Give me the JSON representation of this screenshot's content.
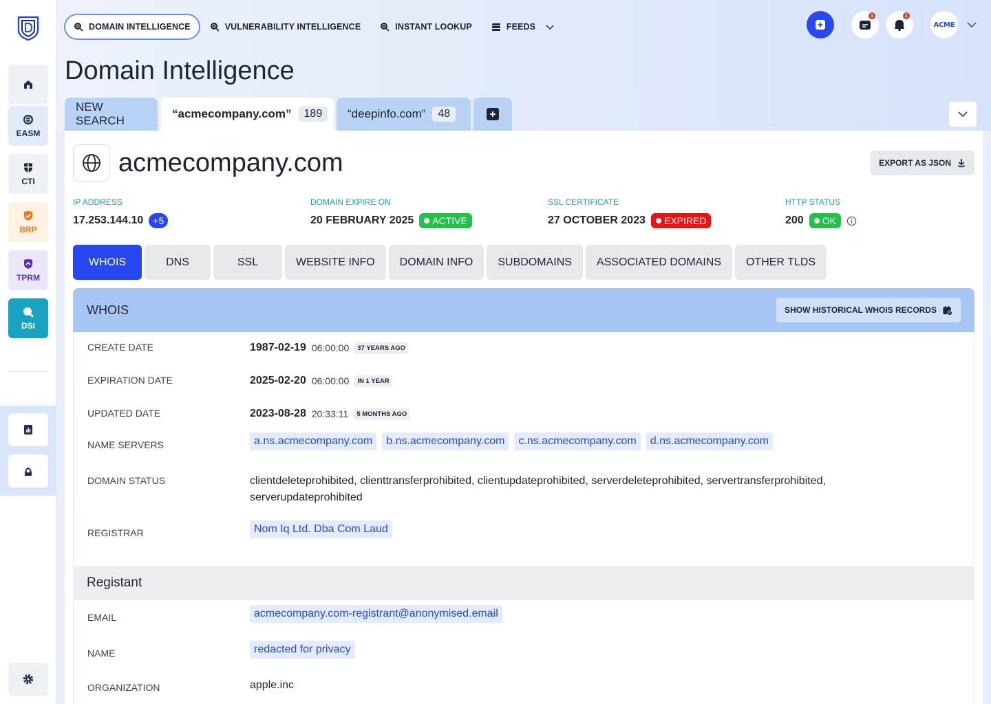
{
  "nav": {
    "items": [
      {
        "label": "DOMAIN INTELLIGENCE",
        "icon": "search-globe-icon"
      },
      {
        "label": "VULNERABILITY INTELLIGENCE",
        "icon": "search-globe-icon"
      },
      {
        "label": "INSTANT LOOKUP",
        "icon": "search-globe-icon"
      },
      {
        "label": "FEEDS",
        "icon": "feeds-icon"
      }
    ],
    "notifications": {
      "messages": "1",
      "alerts": "1"
    },
    "account_logo": "ACME"
  },
  "sidebar": {
    "items": [
      {
        "label": "",
        "icon": "home-icon"
      },
      {
        "label": "EASM",
        "icon": "globe-icon"
      },
      {
        "label": "CTI",
        "icon": "shield-icon"
      },
      {
        "label": "BRP",
        "icon": "shield-check-icon"
      },
      {
        "label": "TPRM",
        "icon": "shield-badge-icon"
      },
      {
        "label": "DSI",
        "icon": "search-icon"
      }
    ]
  },
  "page": {
    "title": "Domain Intelligence"
  },
  "tabs": [
    {
      "label": "NEW SEARCH",
      "count": ""
    },
    {
      "label": "“acmecompany.com”",
      "count": "189"
    },
    {
      "label": "“deepinfo.com”",
      "count": "48"
    }
  ],
  "domain": {
    "name": "acmecompany.com",
    "export_label": "EXPORT AS JSON",
    "meta": {
      "ip": {
        "label": "IP ADDRESS",
        "value": "17.253.144.10",
        "extra": "+5"
      },
      "expire": {
        "label": "DOMAIN EXPIRE ON",
        "value": "20 FEBRUARY 2025",
        "status": "ACTIVE"
      },
      "ssl": {
        "label": "SSL CERTIFICATE",
        "value": "27 OCTOBER 2023",
        "status": "EXPIRED"
      },
      "http": {
        "label": "HTTP STATUS",
        "value": "200",
        "status": "OK"
      }
    }
  },
  "subtabs": [
    "WHOIS",
    "DNS",
    "SSL",
    "WEBSITE INFO",
    "DOMAIN INFO",
    "SUBDOMAINS",
    "ASSOCIATED DOMAINS",
    "OTHER TLDS"
  ],
  "whois": {
    "title": "WHOIS",
    "history_label": "SHOW HISTORICAL WHOIS RECORDS",
    "create": {
      "label": "CREATE DATE",
      "date": "1987-02-19",
      "time": "06:00:00",
      "ago": "37 YEARS AGO"
    },
    "expiration": {
      "label": "EXPIRATION DATE",
      "date": "2025-02-20",
      "time": "06:00:00",
      "ago": "IN 1 YEAR"
    },
    "updated": {
      "label": "UPDATED DATE",
      "date": "2023-08-28",
      "time": "20:33:11",
      "ago": "5 MONTHS AGO"
    },
    "name_servers": {
      "label": "NAME SERVERS",
      "values": [
        "a.ns.acmecompany.com",
        "b.ns.acmecompany.com",
        "c.ns.acmecompany.com",
        "d.ns.acmecompany.com"
      ]
    },
    "status": {
      "label": "DOMAIN STATUS",
      "line1": "clientdeleteprohibited, clienttransferprohibited, clientupdateprohibited, serverdeleteprohibited, servertransferprohibited,",
      "line2": "serverupdateprohibited"
    },
    "registrar": {
      "label": "REGISTRAR",
      "value": "Nom Iq Ltd. Dba Com Laud"
    }
  },
  "registant": {
    "title": "Registant",
    "email": {
      "label": "EMAIL",
      "value": "acmecompany.com-registrant@anonymised.email"
    },
    "name": {
      "label": "NAME",
      "value": "redacted for privacy"
    },
    "org": {
      "label": "ORGANIZATION",
      "value": "apple.inc"
    }
  },
  "colors": {
    "accent": "#2747f0",
    "teal": "#1ba3c4",
    "active": "#23c14a",
    "expired": "#ee1111"
  }
}
